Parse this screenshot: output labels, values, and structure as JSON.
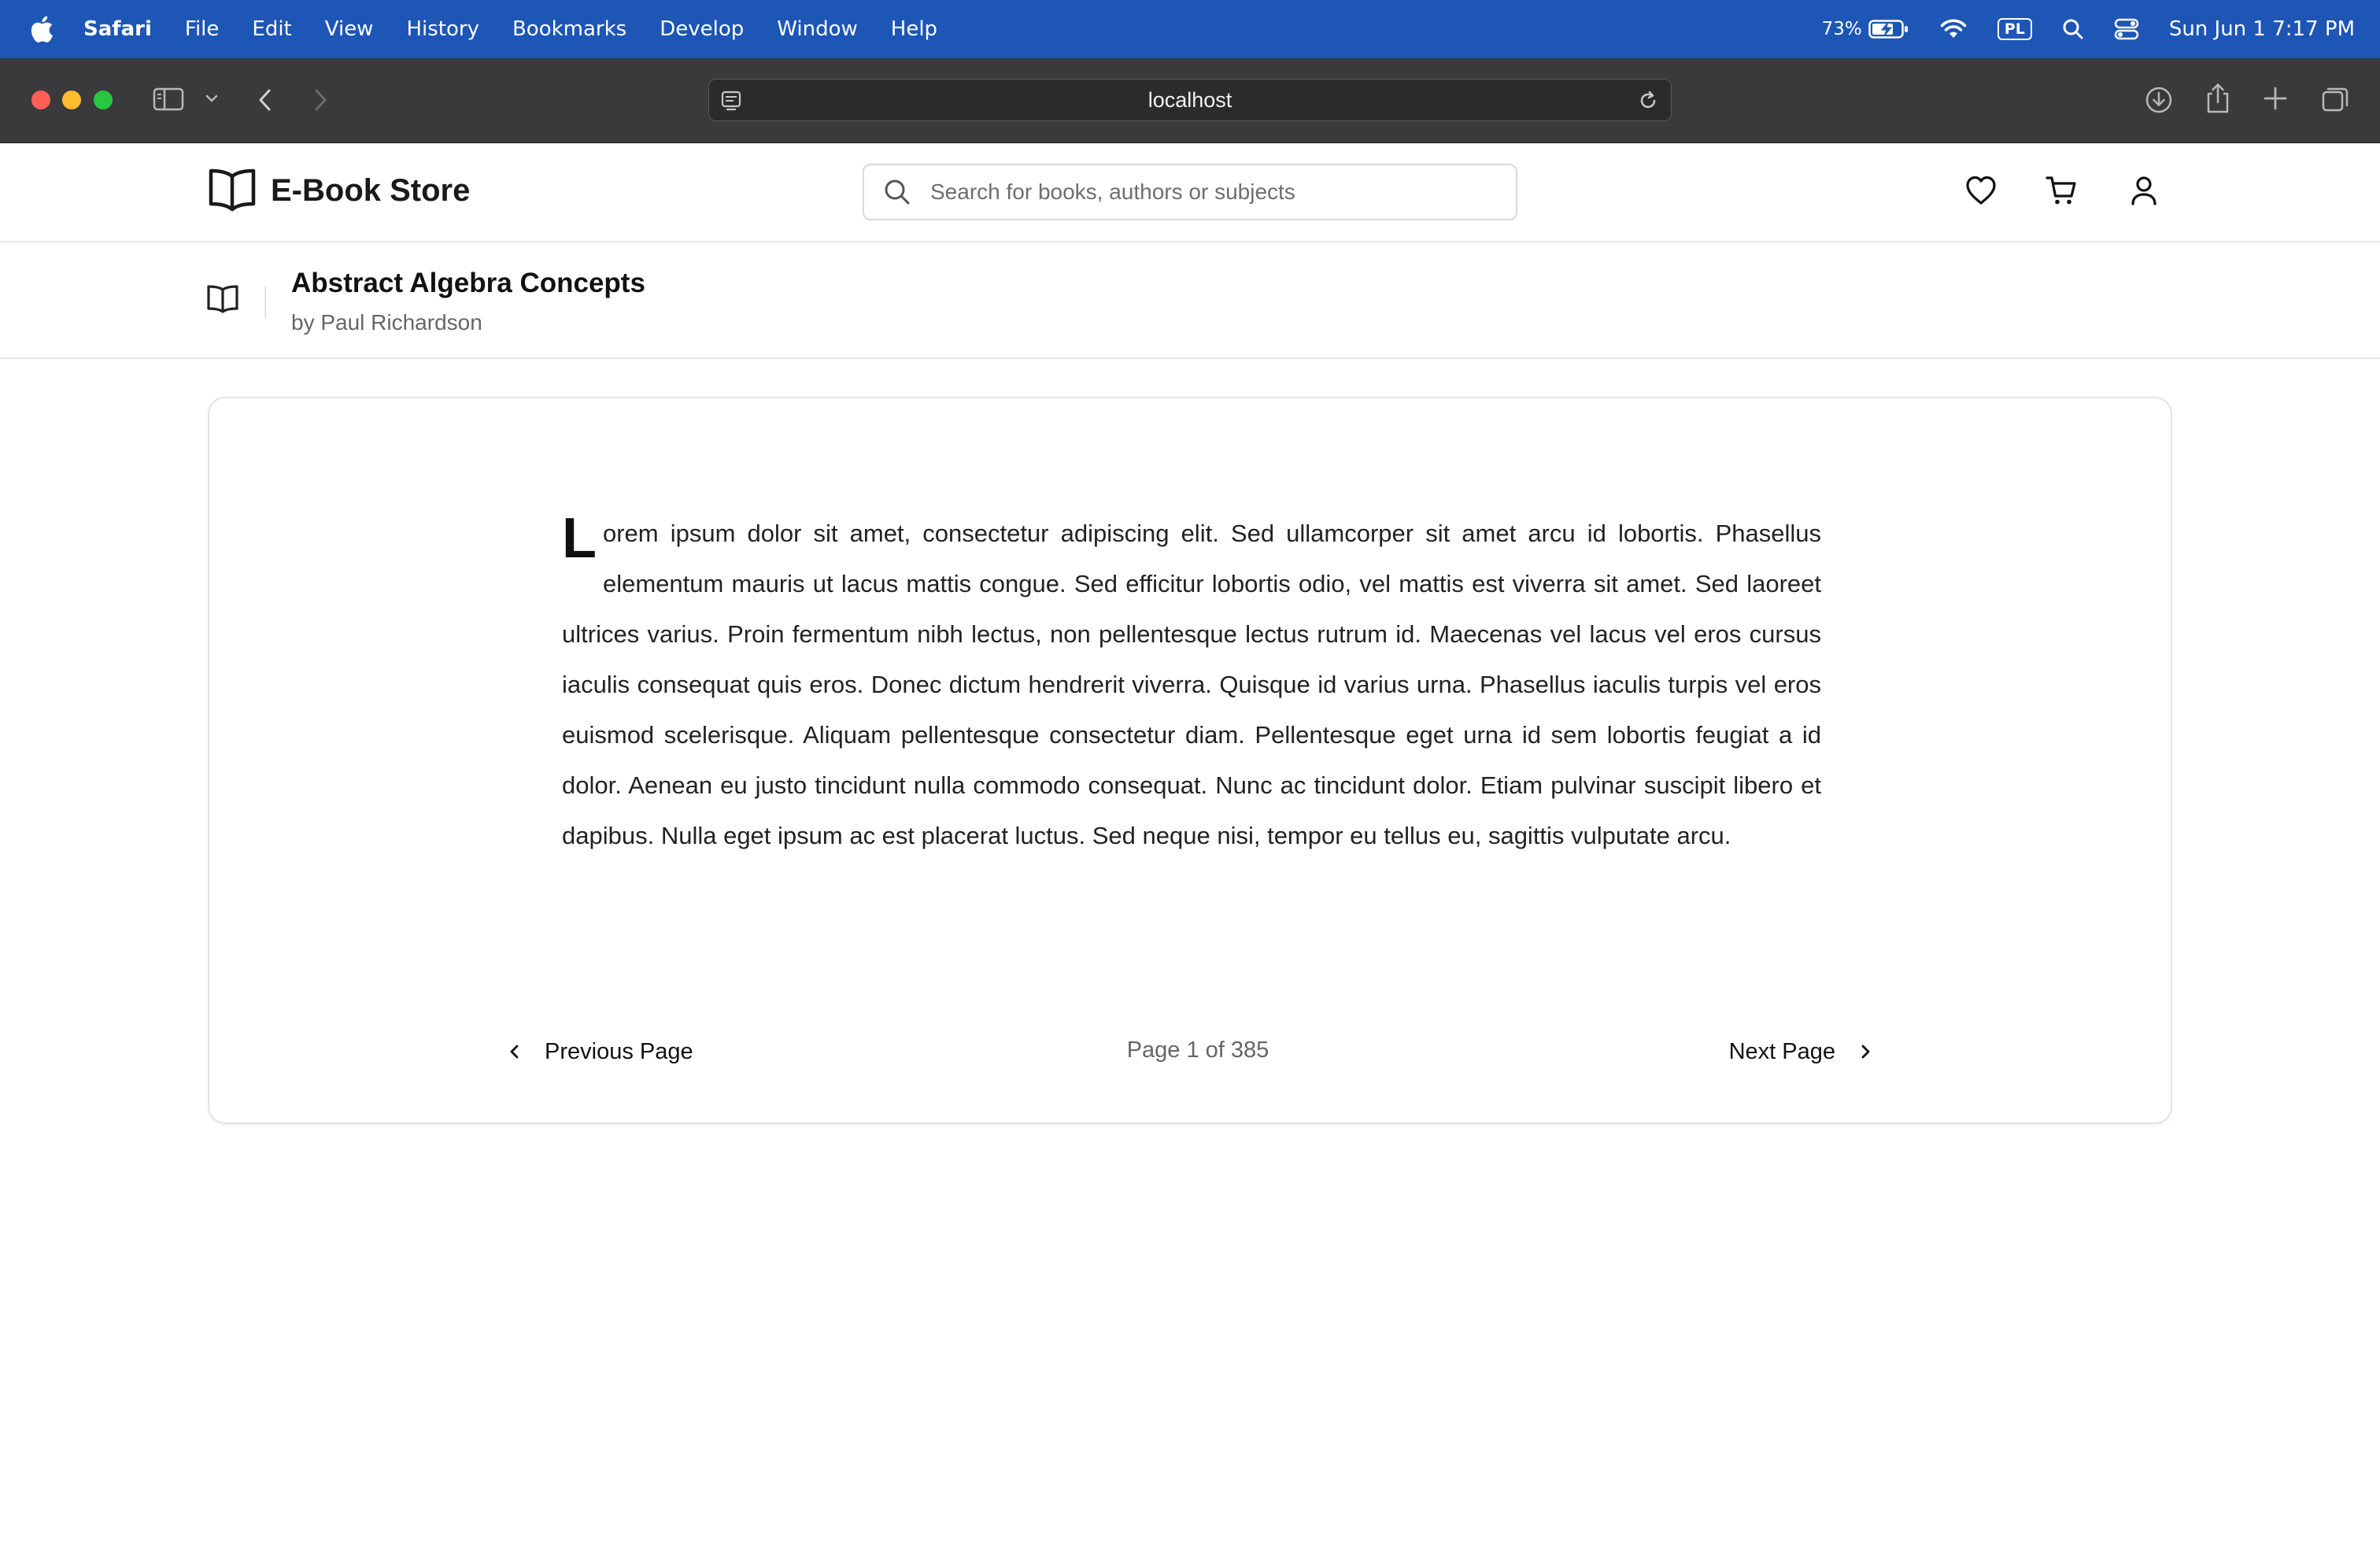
{
  "menubar": {
    "app_name": "Safari",
    "items": [
      "File",
      "Edit",
      "View",
      "History",
      "Bookmarks",
      "Develop",
      "Window",
      "Help"
    ],
    "battery_percent": "73%",
    "input_source": "PL",
    "datetime": "Sun Jun 1  7:17 PM"
  },
  "browser": {
    "url": "localhost"
  },
  "site": {
    "name": "E-Book Store",
    "search_placeholder": "Search for books, authors or subjects"
  },
  "book": {
    "title": "Abstract Algebra Concepts",
    "author_line": "by Paul Richardson"
  },
  "reader": {
    "drop_cap": "L",
    "body_text": "orem ipsum dolor sit amet, consectetur adipiscing elit. Sed ullamcorper sit amet arcu id lobortis. Phasellus elementum mauris ut lacus mattis congue. Sed efficitur lobortis odio, vel mattis est viverra sit amet. Sed laoreet ultrices varius. Proin fermentum nibh lectus, non pellentesque lectus rutrum id. Maecenas vel lacus vel eros cursus iaculis consequat quis eros. Donec dictum hendrerit viverra. Quisque id varius urna. Phasellus iaculis turpis vel eros euismod scelerisque. Aliquam pellentesque consectetur diam. Pellentesque eget urna id sem lobortis feugiat a id dolor. Aenean eu justo tincidunt nulla commodo consequat. Nunc ac tincidunt dolor. Etiam pulvinar suscipit libero et dapibus. Nulla eget ipsum ac est placerat luctus. Sed neque nisi, tempor eu tellus eu, sagittis vulputate arcu.",
    "prev_label": "Previous Page",
    "next_label": "Next Page",
    "page_indicator": "Page 1 of 385"
  }
}
